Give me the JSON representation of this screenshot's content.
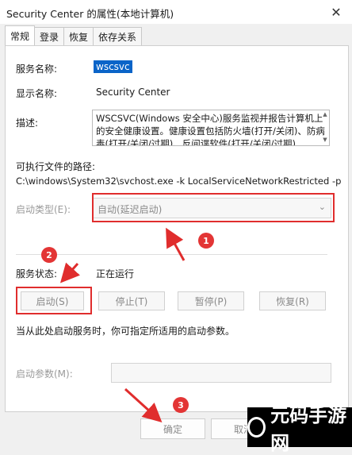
{
  "window": {
    "title": "Security Center 的属性(本地计算机)",
    "close_glyph": "✕"
  },
  "tabs": [
    "常规",
    "登录",
    "恢复",
    "依存关系"
  ],
  "fields": {
    "service_name_label": "服务名称:",
    "service_name_value": "wscsvc",
    "display_name_label": "显示名称:",
    "display_name_value": "Security Center",
    "description_label": "描述:",
    "description_text": "WSCSVC(Windows 安全中心)服务监视并报告计算机上的安全健康设置。健康设置包括防火墙(打开/关闭)、防病毒(打开/关闭/过期)、反间谍软件(打开/关闭/过期)",
    "exe_path_label": "可执行文件的路径:",
    "exe_path_value": "C:\\windows\\System32\\svchost.exe -k LocalServiceNetworkRestricted -p",
    "startup_type_label": "启动类型(E):",
    "startup_type_value": "自动(延迟启动)",
    "service_status_label": "服务状态:",
    "service_status_value": "正在运行"
  },
  "buttons": {
    "start": "启动(S)",
    "stop": "停止(T)",
    "pause": "暂停(P)",
    "resume": "恢复(R)"
  },
  "hint_text": "当从此处启动服务时，你可指定所适用的启动参数。",
  "start_params_label": "启动参数(M):",
  "dialog_buttons": {
    "ok": "确定",
    "cancel": "取消"
  },
  "annotations": {
    "badge1": "1",
    "badge2": "2",
    "badge3": "3"
  },
  "watermark": {
    "text": "元码手游网"
  },
  "colors": {
    "selection": "#0a64c8",
    "annotation_red": "#e02d2d"
  }
}
